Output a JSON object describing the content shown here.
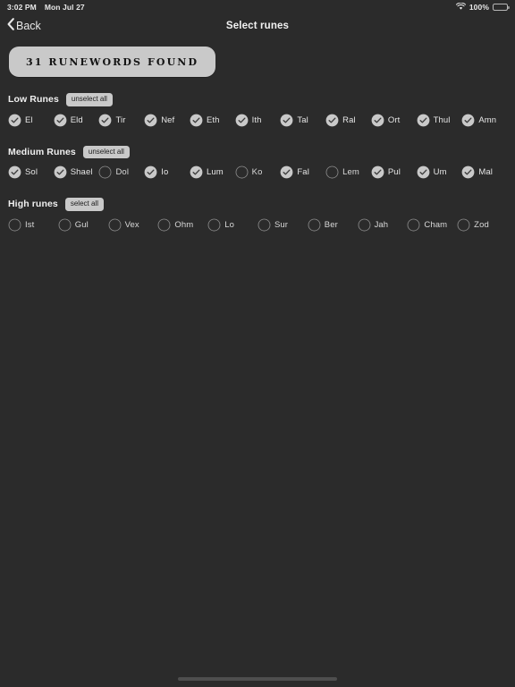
{
  "status_bar": {
    "time": "3:02 PM",
    "date": "Mon Jul 27",
    "wifi_icon": "wifi-icon",
    "battery_percent": "100%",
    "battery_icon": "battery-full-icon"
  },
  "nav_bar": {
    "back_label": "Back",
    "back_icon": "chevron-left-icon",
    "title": "Select runes"
  },
  "banner": {
    "label": "31 RUNEWORDS FOUND",
    "count": 31,
    "background_color": "#c9c9c9",
    "text_color": "#141414"
  },
  "theme": {
    "background": "#2b2b2b",
    "accent": "#c9c9c9",
    "text": "#e8e8e8"
  },
  "sections": [
    {
      "title": "Low Runes",
      "action_label": "unselect all",
      "action_name": "unselect-all-low-runes-button",
      "runes": [
        {
          "name": "El",
          "checked": true
        },
        {
          "name": "Eld",
          "checked": true
        },
        {
          "name": "Tir",
          "checked": true
        },
        {
          "name": "Nef",
          "checked": true
        },
        {
          "name": "Eth",
          "checked": true
        },
        {
          "name": "Ith",
          "checked": true
        },
        {
          "name": "Tal",
          "checked": true
        },
        {
          "name": "Ral",
          "checked": true
        },
        {
          "name": "Ort",
          "checked": true
        },
        {
          "name": "Thul",
          "checked": true
        },
        {
          "name": "Amn",
          "checked": true
        }
      ]
    },
    {
      "title": "Medium Runes",
      "action_label": "unselect all",
      "action_name": "unselect-all-medium-runes-button",
      "runes": [
        {
          "name": "Sol",
          "checked": true
        },
        {
          "name": "Shael",
          "checked": true
        },
        {
          "name": "Dol",
          "checked": false
        },
        {
          "name": "Io",
          "checked": true
        },
        {
          "name": "Lum",
          "checked": true
        },
        {
          "name": "Ko",
          "checked": false
        },
        {
          "name": "Fal",
          "checked": true
        },
        {
          "name": "Lem",
          "checked": false
        },
        {
          "name": "Pul",
          "checked": true
        },
        {
          "name": "Um",
          "checked": true
        },
        {
          "name": "Mal",
          "checked": true
        }
      ]
    },
    {
      "title": "High runes",
      "action_label": "select all",
      "action_name": "select-all-high-runes-button",
      "runes": [
        {
          "name": "Ist",
          "checked": false
        },
        {
          "name": "Gul",
          "checked": false
        },
        {
          "name": "Vex",
          "checked": false
        },
        {
          "name": "Ohm",
          "checked": false
        },
        {
          "name": "Lo",
          "checked": false
        },
        {
          "name": "Sur",
          "checked": false
        },
        {
          "name": "Ber",
          "checked": false
        },
        {
          "name": "Jah",
          "checked": false
        },
        {
          "name": "Cham",
          "checked": false
        },
        {
          "name": "Zod",
          "checked": false
        }
      ]
    }
  ]
}
